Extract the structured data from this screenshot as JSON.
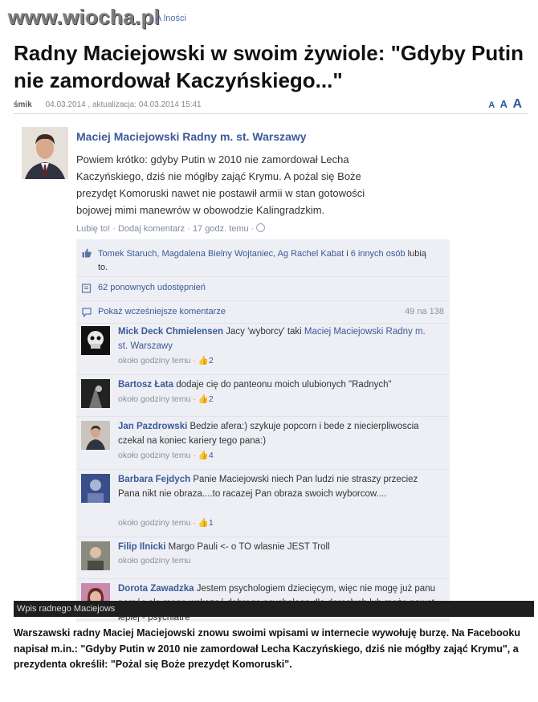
{
  "site": {
    "watermark": "www.wiocha.pl",
    "crumb": "A  lności"
  },
  "article": {
    "headline": "Radny Maciejowski w swoim żywiole: \"Gdyby Putin nie zamordował Kaczyńskiego...\"",
    "author": "śmik",
    "date_line": "04.03.2014 , aktualizacja: 04.03.2014 15:41",
    "font_sizes": [
      "A",
      "A",
      "A"
    ],
    "caption": "Wpis radnego Maciejows",
    "lead": "Warszawski radny Maciej Maciejowski znowu swoimi wpisami w internecie wywołuję burzę. Na Facebooku napisał m.in.: \"Gdyby Putin w 2010 nie zamordował Lecha Kaczyńskiego, dziś nie mógłby zająć Krymu\", a prezydenta określił: \"Pożal się Boże prezydęt Komoruski\"."
  },
  "post": {
    "author": "Maciej Maciejowski Radny m. st. Warszawy",
    "text": "Powiem krótko: gdyby Putin w 2010 nie zamordował Lecha Kaczyńskiego, dziś nie mógłby zająć Krymu. A pożal się Boże prezydęt Komoruski nawet nie postawił armii w stan gotowości bojowej mimi manewrów w obowodzie Kalingradzkim.",
    "like": "Lubię to!",
    "comment": "Dodaj komentarz",
    "time": "17 godz. temu",
    "likes_names": "Tomek Staruch, Magdalena Bielny Wojtaniec, Ag Rachel Kabat",
    "likes_and": " i ",
    "likes_others": "6 innych osób",
    "likes_suffix": " lubią to.",
    "shares": "62 ponownych udostępnień",
    "show_earlier": "Pokaż wcześniejsze komentarze",
    "count": "49 na 138"
  },
  "comments": [
    {
      "name": "Mick Deck Chmielensen",
      "text": " Jacy 'wyborcy' taki ",
      "mention": "Maciej Maciejowski Radny m. st. Warszawy",
      "time": "około godziny temu",
      "likes": "2"
    },
    {
      "name": "Bartosz Łata",
      "text": " dodaje cię do panteonu moich ulubionych \"Radnych\"",
      "time": "około godziny temu",
      "likes": "2"
    },
    {
      "name": "Jan Pazdrowski",
      "text": " Bedzie afera:) szykuje popcorn i bede z niecierpliwoscia czekal na koniec kariery tego pana:)",
      "time": "około godziny temu",
      "likes": "4"
    },
    {
      "name": "Barbara Fejdych",
      "text": " Panie Maciejowski niech Pan ludzi nie straszy przeciez Pana nikt nie obraza....to racazej Pan obraza swoich wyborcow....",
      "time": "około godziny temu",
      "likes": "1"
    },
    {
      "name": "Filip Ilnicki",
      "text": " Margo Pauli <- o TO wlasnie JEST Troll",
      "time": "około godziny temu",
      "likes": ""
    },
    {
      "name": "Dorota Zawadzka",
      "text": " Jestem psychologiem dziecięcym, więc nie mogę już panu pomóc ale mogę wskazać dobrego psychologa dla dorosłych lub może nawet lepiej - psychiatre",
      "time": "",
      "likes": ""
    }
  ],
  "colors": {
    "fb_blue": "#3b5998",
    "fb_panel": "#edeff4",
    "caption_bg": "#1f1f1f"
  }
}
